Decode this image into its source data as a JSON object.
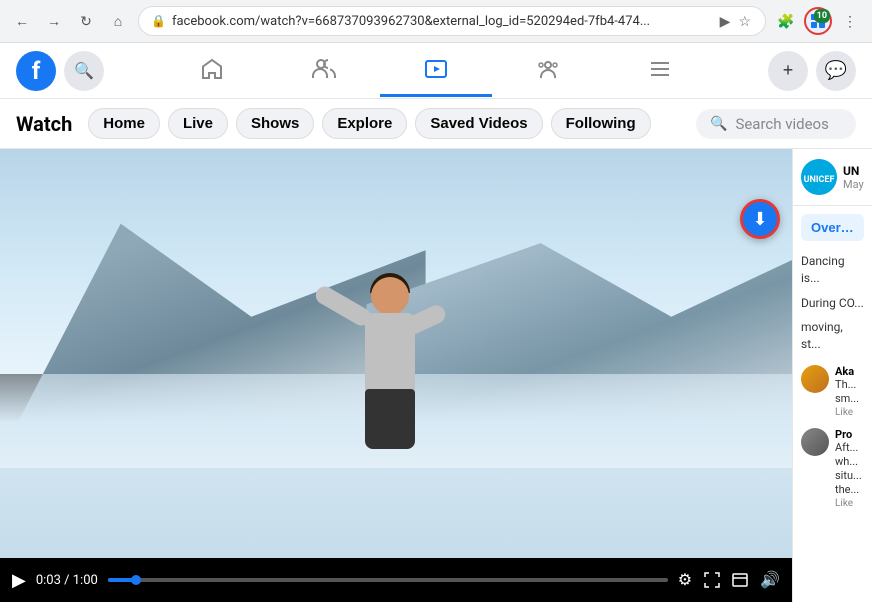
{
  "browser": {
    "back_disabled": false,
    "forward_disabled": false,
    "url": "facebook.com/watch?v=668737093962730&external_log_id=520294ed-7fb4-474...",
    "extension_badge": "10",
    "nav_btns": [
      "←",
      "→",
      "↻",
      "⌂"
    ]
  },
  "facebook": {
    "logo_letter": "f",
    "nav_items": [
      {
        "name": "home",
        "icon": "⌂",
        "active": false
      },
      {
        "name": "friends",
        "icon": "👥",
        "active": false
      },
      {
        "name": "watch",
        "icon": "▶",
        "active": true
      },
      {
        "name": "groups",
        "icon": "😊",
        "active": false
      },
      {
        "name": "menu",
        "icon": "☰",
        "active": false
      }
    ],
    "right_btns": [
      "+",
      "💬"
    ]
  },
  "watch_header": {
    "title": "Watch",
    "nav_items": [
      {
        "label": "Home"
      },
      {
        "label": "Live"
      },
      {
        "label": "Shows"
      },
      {
        "label": "Explore"
      },
      {
        "label": "Saved Videos"
      },
      {
        "label": "Following"
      }
    ],
    "search_placeholder": "Search videos"
  },
  "video": {
    "current_time": "0:03",
    "duration": "1:00",
    "progress_percent": 5
  },
  "sidebar": {
    "channel_name": "UN",
    "channel_date": "May",
    "overview_label": "Overview",
    "description_1": "Dancing is...",
    "description_2": "During CO...",
    "description_3": "moving, st...",
    "comments": [
      {
        "name": "Aka",
        "text": "Th... sm...",
        "like": "Like"
      },
      {
        "name": "Pro",
        "text": "Aft... wh... situ... the...",
        "like": "Like"
      }
    ]
  },
  "icons": {
    "play": "▶",
    "settings": "⚙",
    "fullscreen": "⛶",
    "theater": "⧉",
    "volume": "🔊",
    "download": "⬇",
    "lock": "🔒",
    "search": "🔍",
    "back": "←",
    "forward": "→",
    "refresh": "↻",
    "home_browser": "⌂",
    "bookmark": "☆",
    "extensions": "🧩"
  }
}
